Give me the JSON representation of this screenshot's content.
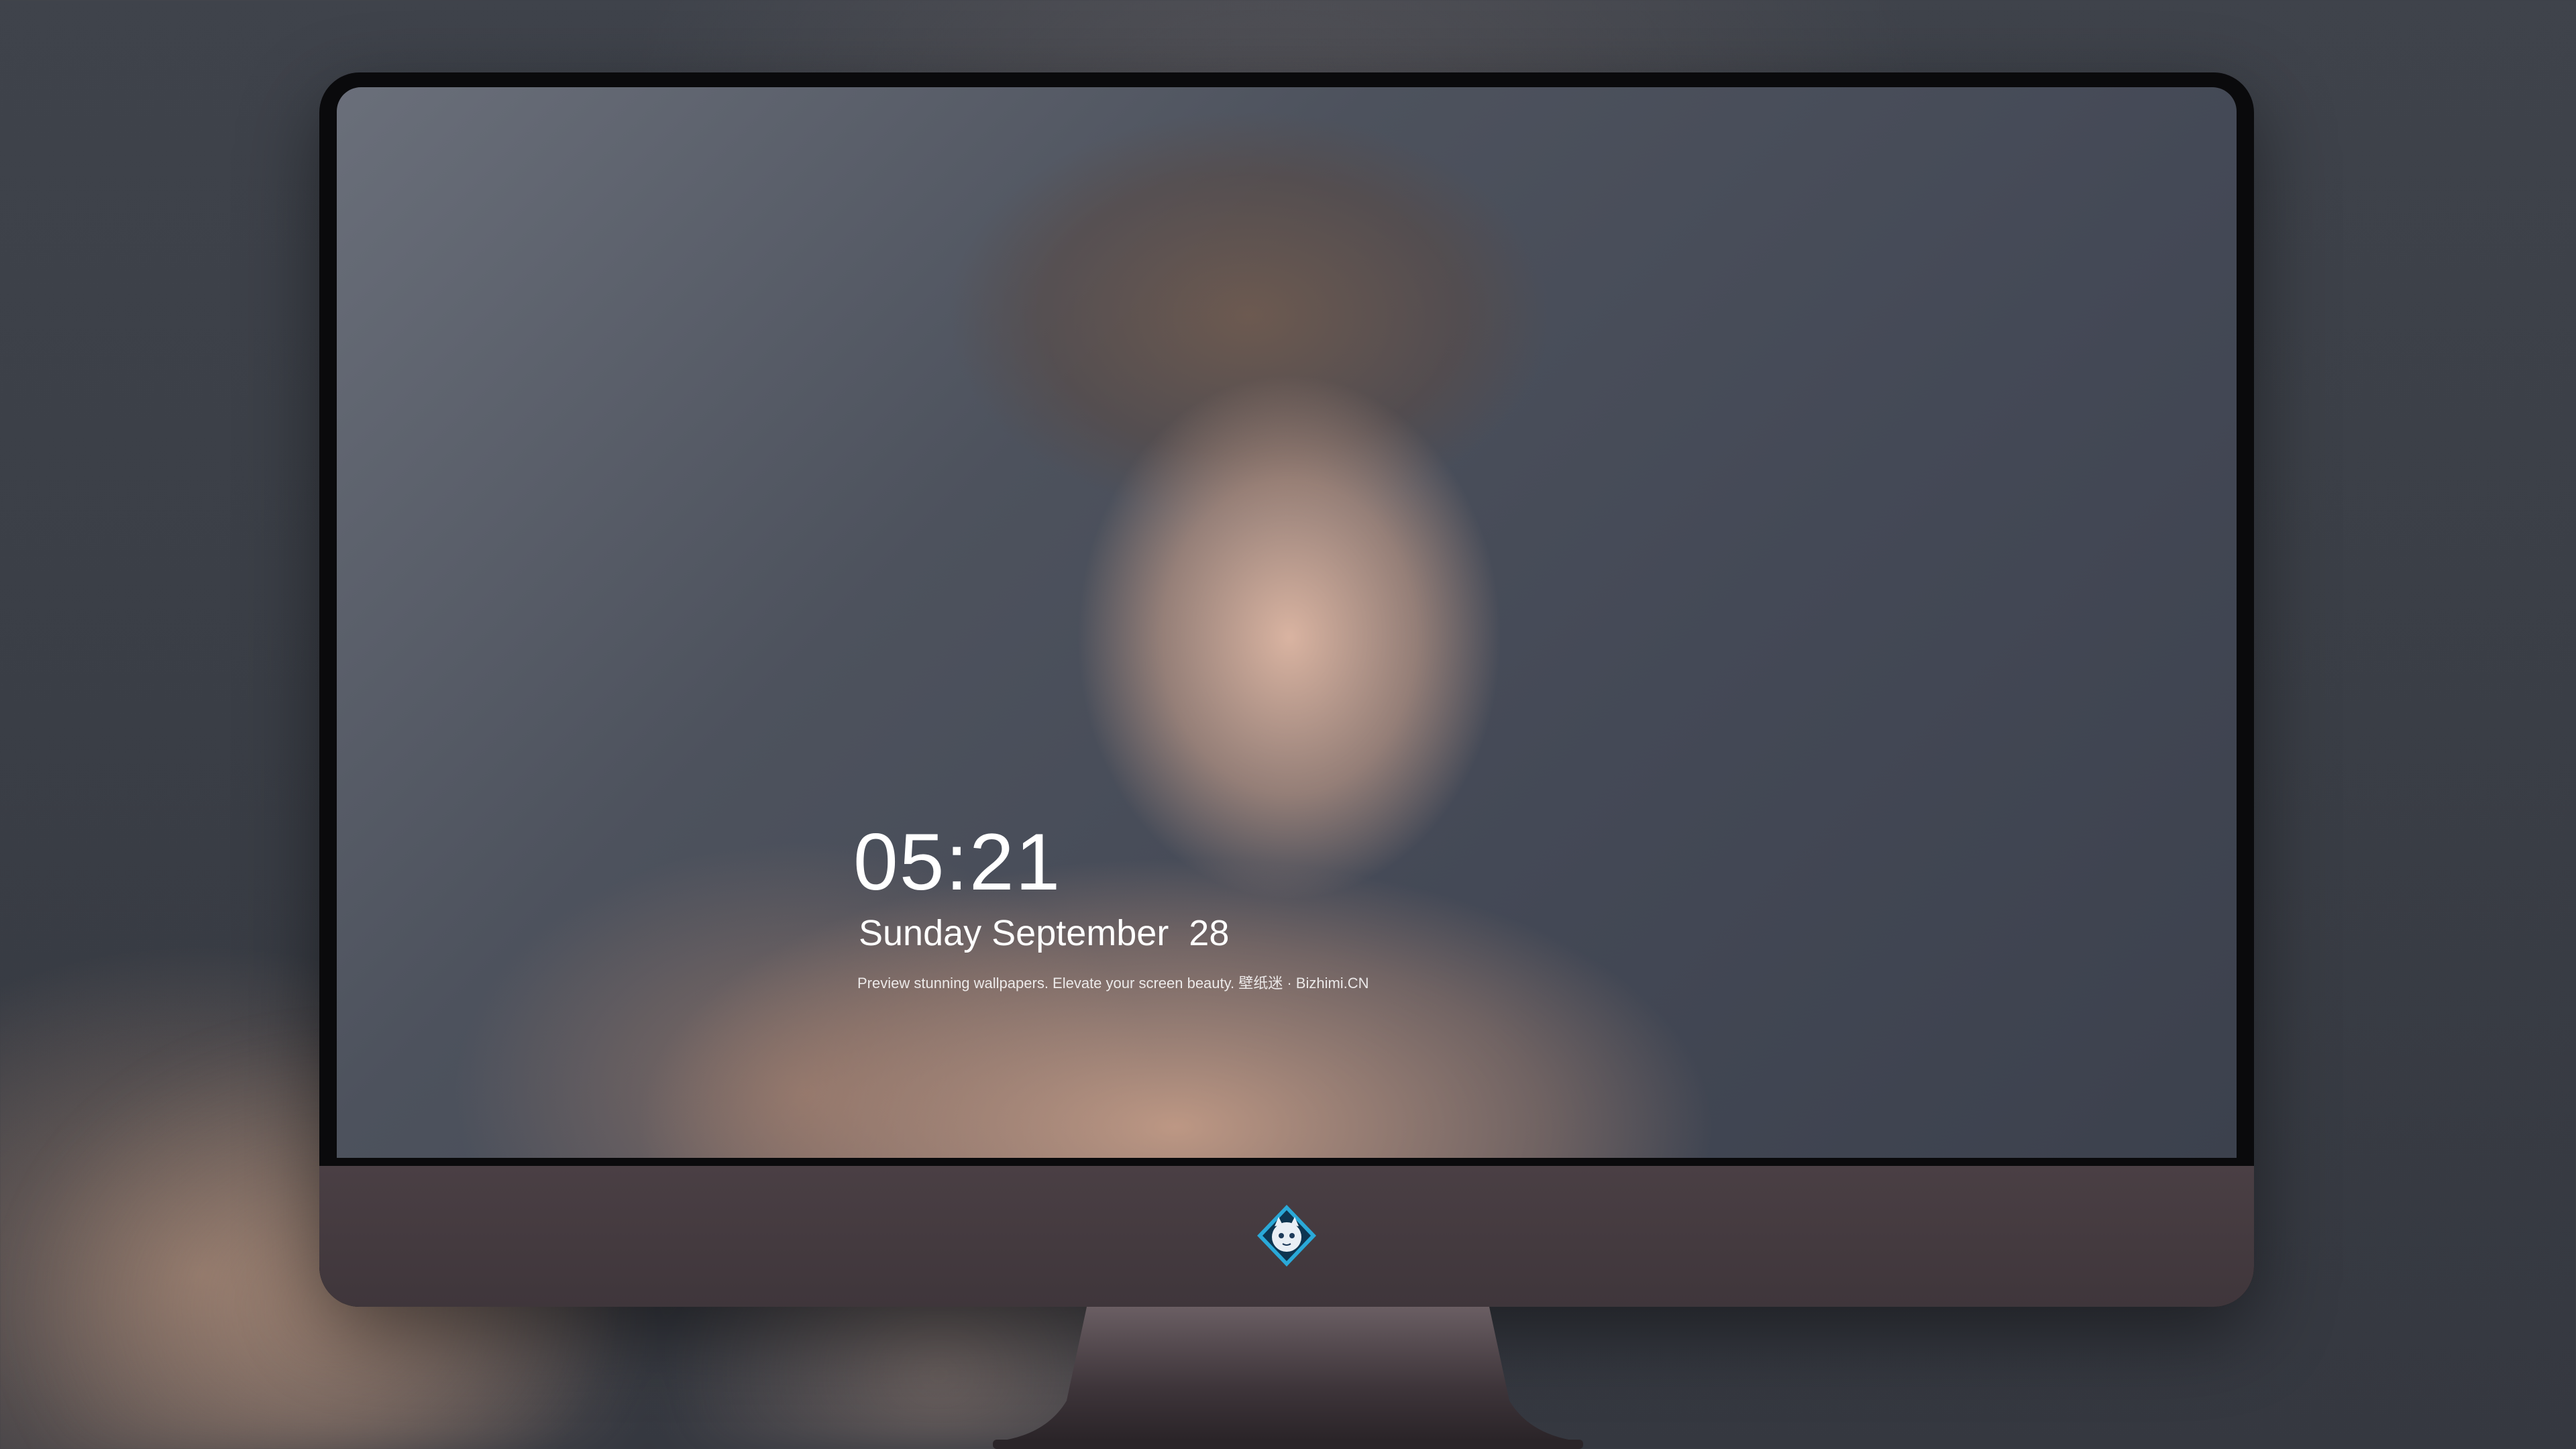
{
  "lock_screen": {
    "time": "05:21",
    "date": "Sunday September  28",
    "caption": "Preview stunning wallpapers. Elevate your screen beauty. 壁纸迷 · Bizhimi.CN"
  },
  "dock": {
    "items": [
      {
        "name": "messages-icon",
        "color": "#34c759"
      },
      {
        "name": "weather-icon",
        "color": "#2f8cf0"
      },
      {
        "name": "clock-icon",
        "color": "#1c1c1e"
      },
      {
        "name": "preview-icon",
        "color": "#e8c45a"
      },
      {
        "name": "clips-icon",
        "color": "#45b5d8"
      },
      {
        "name": "notes-icon",
        "color": "#f5d54e"
      },
      {
        "name": "photo-booth-icon",
        "color": "#e6e6e6"
      },
      {
        "name": "itunes-icon",
        "color": "#d243d6"
      },
      {
        "name": "app-store-icon",
        "color": "#1a8cf5"
      },
      {
        "name": "camera-icon",
        "color": "#9a9a9a"
      }
    ]
  },
  "monitor": {
    "bezel_color": "#0a0a0c",
    "chin_color": "#443a3f",
    "logo": "mascot-logo"
  }
}
